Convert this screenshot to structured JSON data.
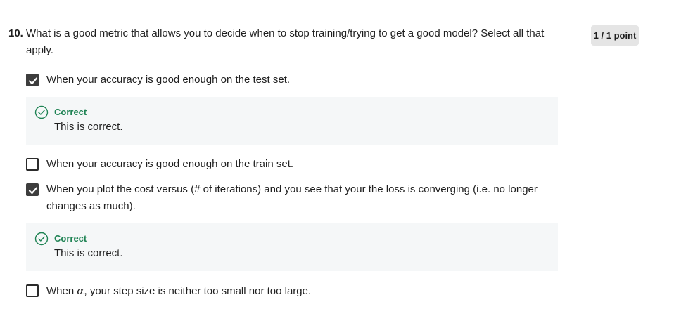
{
  "question": {
    "number": "10.",
    "text": "What is a good metric that allows you to decide when to stop training/trying to get a good model? Select all that apply.",
    "points": "1 / 1 point"
  },
  "options": [
    {
      "label": "When your accuracy is good enough on the test set.",
      "checked": true,
      "feedback": {
        "status": "Correct",
        "text": "This is correct."
      }
    },
    {
      "label": "When your accuracy is good enough on the train set.",
      "checked": false
    },
    {
      "label": "When you plot the cost versus (# of iterations) and you see that your the loss is converging (i.e. no longer changes as much).",
      "checked": true,
      "feedback": {
        "status": "Correct",
        "text": "This is correct."
      }
    },
    {
      "label_prefix": "When ",
      "label_symbol": "α",
      "label_suffix": ", your step size is neither too small nor too large.",
      "checked": false
    }
  ],
  "colors": {
    "correct": "#1f8354",
    "feedback_bg": "#f5f7f8",
    "badge_bg": "#e5e5e5",
    "checkbox_checked": "#3d3d3d"
  },
  "icons": {
    "checked": "checkmark-icon",
    "feedback": "check-circle-icon"
  }
}
